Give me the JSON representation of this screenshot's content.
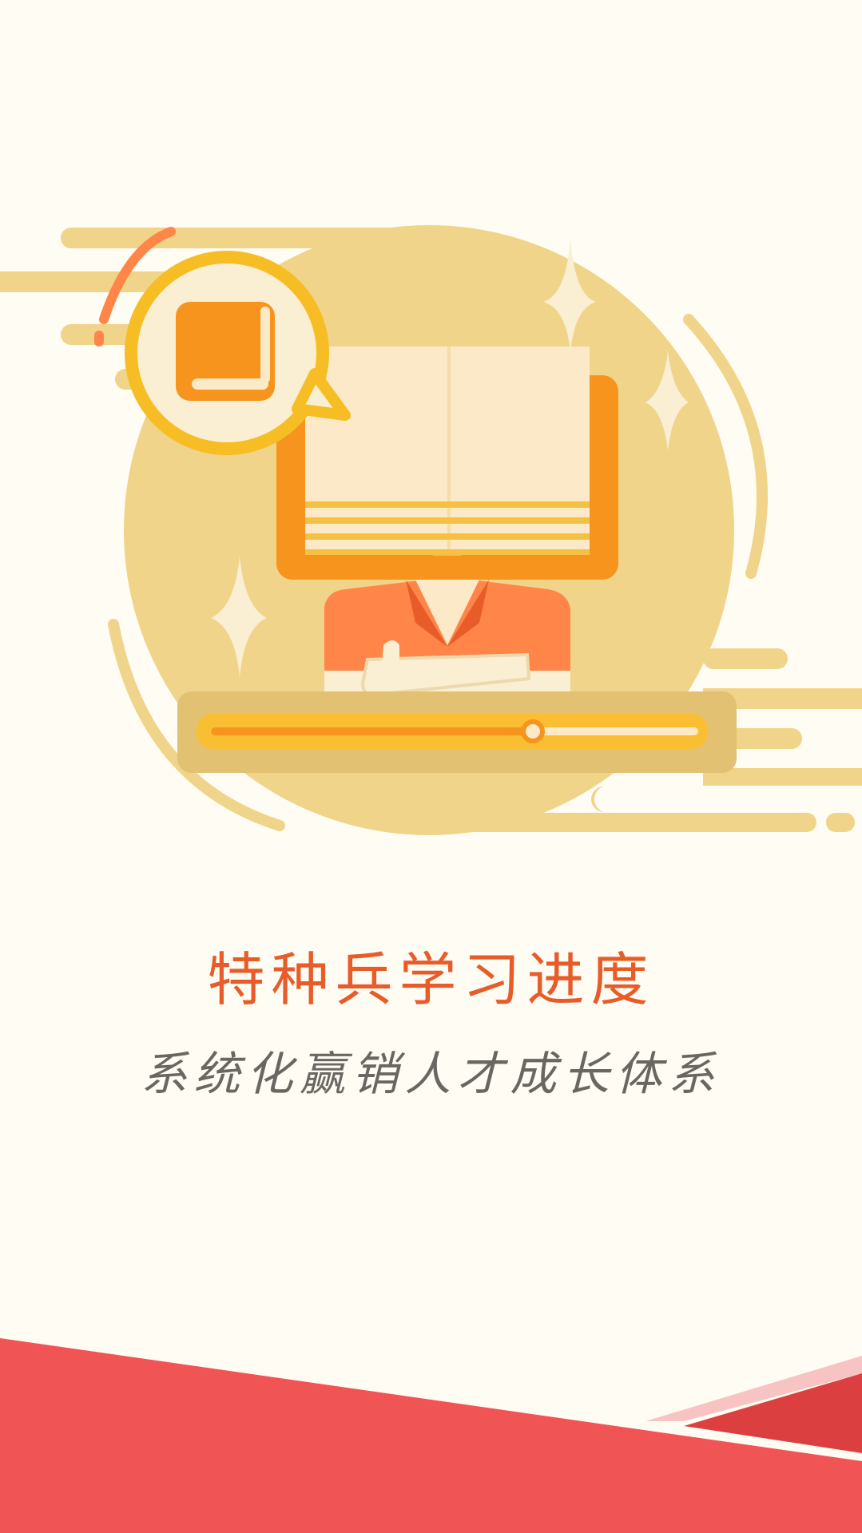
{
  "splash": {
    "title": "特种兵学习进度",
    "subtitle": "系统化赢销人才成长体系",
    "progress_fraction": 0.66
  },
  "colors": {
    "background": "#FEFCF3",
    "accent_orange": "#F7941D",
    "title_red": "#E85C2A",
    "footer_red": "#F05454",
    "circle_yellow": "#F0D48A"
  },
  "icons": [
    "book-icon",
    "open-book-illustration",
    "sparkle-icon",
    "thumbs-up-figure"
  ]
}
